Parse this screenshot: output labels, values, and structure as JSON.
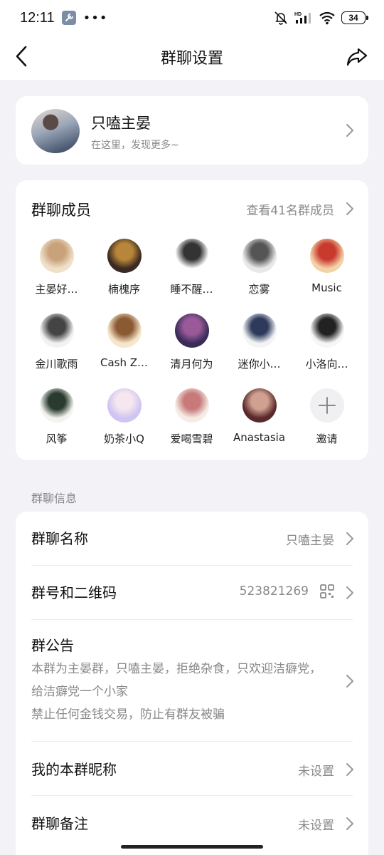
{
  "status_bar": {
    "time": "12:11",
    "dots": "•••",
    "wifi_label": "HD",
    "battery": "34"
  },
  "header": {
    "title": "群聊设置"
  },
  "group": {
    "name": "只嗑主晏",
    "subtitle": "在这里，发现更多~"
  },
  "members": {
    "title": "群聊成员",
    "view_all": "查看41名群成员",
    "list": [
      {
        "name": "主晏好…",
        "colors": [
          "#efe0c8",
          "#c8a27a"
        ]
      },
      {
        "name": "楠槐序",
        "colors": [
          "#3a2a22",
          "#b8863a"
        ]
      },
      {
        "name": "睡不醒…",
        "colors": [
          "#ffffff",
          "#333333"
        ]
      },
      {
        "name": "恋雾",
        "colors": [
          "#e8e8e8",
          "#555555"
        ]
      },
      {
        "name": "Music",
        "colors": [
          "#f4d2a8",
          "#c93a2e"
        ]
      },
      {
        "name": "金川歌雨",
        "colors": [
          "#f2f2f2",
          "#444444"
        ]
      },
      {
        "name": "Cash Z…",
        "colors": [
          "#f6e6cc",
          "#8a5a32"
        ]
      },
      {
        "name": "清月何为",
        "colors": [
          "#3a2c58",
          "#9a5a9a"
        ]
      },
      {
        "name": "迷你小…",
        "colors": [
          "#f4f4f6",
          "#2e3a5c"
        ]
      },
      {
        "name": "小洛向…",
        "colors": [
          "#f6f6f6",
          "#222222"
        ]
      },
      {
        "name": "风筝",
        "colors": [
          "#f2f4ee",
          "#2a3a2e"
        ]
      },
      {
        "name": "奶茶小Q",
        "colors": [
          "#cfc4f2",
          "#f6e6ee"
        ]
      },
      {
        "name": "爱喝雪碧",
        "colors": [
          "#f6ece6",
          "#c87a7a"
        ]
      },
      {
        "name": "Anastasia",
        "colors": [
          "#5a2a2a",
          "#d0a090"
        ]
      }
    ],
    "invite_label": "邀请"
  },
  "info_section": {
    "label": "群聊信息",
    "name_row": {
      "title": "群聊名称",
      "value": "只嗑主晏"
    },
    "number_row": {
      "title": "群号和二维码",
      "value": "523821269"
    },
    "notice_row": {
      "title": "群公告",
      "line1": "本群为主晏群，只嗑主晏，拒绝杂食，只欢迎洁癖党，给洁癖党一个小家",
      "line2": "禁止任何金钱交易，防止有群友被骗"
    },
    "nickname_row": {
      "title": "我的本群昵称",
      "value": "未设置"
    },
    "remark_row": {
      "title": "群聊备注",
      "value": "未设置"
    }
  },
  "colors": {
    "background": "#f2f2f7",
    "card": "#ffffff",
    "secondary_text": "#888888"
  }
}
